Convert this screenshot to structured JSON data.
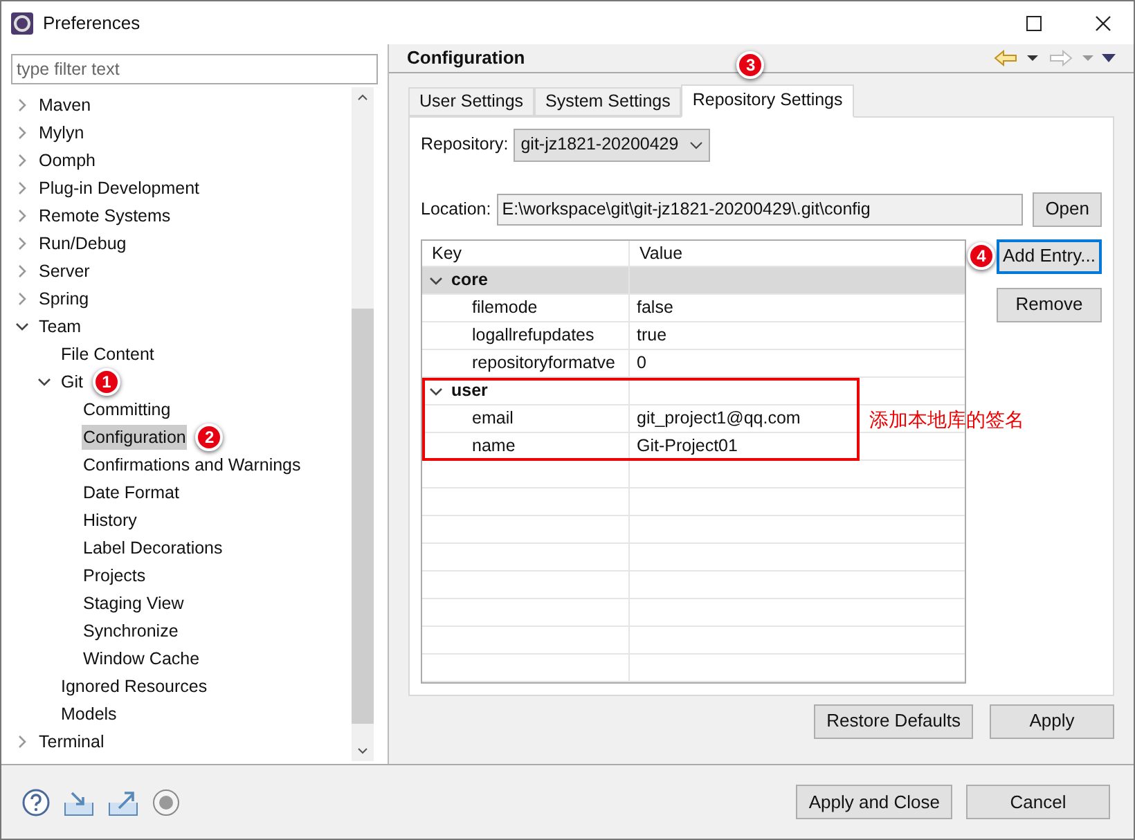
{
  "window": {
    "title": "Preferences"
  },
  "filter": {
    "placeholder": "type filter text"
  },
  "tree": [
    {
      "label": "Maven",
      "expanded": false
    },
    {
      "label": "Mylyn",
      "expanded": false
    },
    {
      "label": "Oomph",
      "expanded": false
    },
    {
      "label": "Plug-in Development",
      "expanded": false
    },
    {
      "label": "Remote Systems",
      "expanded": false
    },
    {
      "label": "Run/Debug",
      "expanded": false
    },
    {
      "label": "Server",
      "expanded": false
    },
    {
      "label": "Spring",
      "expanded": false
    },
    {
      "label": "Team",
      "expanded": true,
      "children": [
        {
          "label": "File Content",
          "selected": false
        },
        {
          "label": "Git",
          "expanded": true,
          "badge": "1",
          "children": [
            {
              "label": "Committing",
              "selected": false
            },
            {
              "label": "Configuration",
              "selected": true,
              "badge": "2"
            },
            {
              "label": "Confirmations and Warnings",
              "selected": false
            },
            {
              "label": "Date Format",
              "selected": false
            },
            {
              "label": "History",
              "selected": false
            },
            {
              "label": "Label Decorations",
              "selected": false
            },
            {
              "label": "Projects",
              "selected": false
            },
            {
              "label": "Staging View",
              "selected": false
            },
            {
              "label": "Synchronize",
              "selected": false
            },
            {
              "label": "Window Cache",
              "selected": false
            }
          ]
        },
        {
          "label": "Ignored Resources",
          "selected": false
        },
        {
          "label": "Models",
          "selected": false
        }
      ]
    },
    {
      "label": "Terminal",
      "expanded": false
    }
  ],
  "page_title": "Configuration",
  "tabs": [
    {
      "label": "User Settings",
      "selected": false
    },
    {
      "label": "System Settings",
      "selected": false
    },
    {
      "label": "Repository Settings",
      "selected": true,
      "badge": "3"
    }
  ],
  "repository": {
    "label": "Repository:",
    "value": "git-jz1821-20200429"
  },
  "location": {
    "label": "Location:",
    "value": "E:\\workspace\\git\\git-jz1821-20200429\\.git\\config",
    "button": "Open"
  },
  "table": {
    "columns": [
      "Key",
      "Value"
    ],
    "sections": [
      {
        "name": "core",
        "expanded": true,
        "highlighted": true,
        "rows": [
          {
            "key": "filemode",
            "value": "false"
          },
          {
            "key": "logallrefupdates",
            "value": "true"
          },
          {
            "key": "repositoryformatve",
            "value": "0"
          }
        ]
      },
      {
        "name": "user",
        "expanded": true,
        "highlighted": false,
        "rows": [
          {
            "key": "email",
            "value": "git_project1@qq.com"
          },
          {
            "key": "name",
            "value": "Git-Project01"
          }
        ]
      }
    ]
  },
  "side_buttons": [
    {
      "label": "Add Entry...",
      "badge": "4",
      "focused": true
    },
    {
      "label": "Remove",
      "focused": false
    }
  ],
  "note": "添加本地库的签名",
  "page_buttons": [
    "Restore Defaults",
    "Apply"
  ],
  "dialog_buttons": [
    "Apply and Close",
    "Cancel"
  ]
}
